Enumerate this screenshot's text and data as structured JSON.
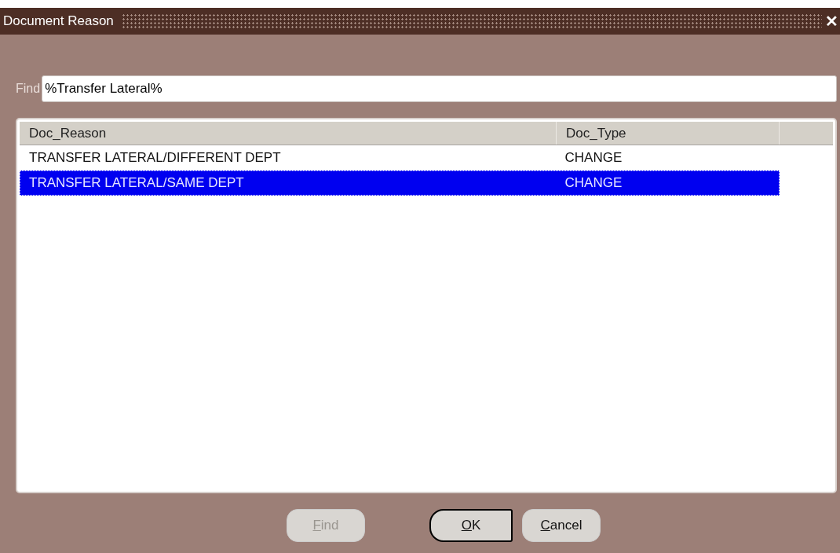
{
  "window": {
    "title": "Document Reason",
    "close": "✕"
  },
  "find": {
    "label": "Find",
    "value": "%Transfer Lateral%"
  },
  "table": {
    "columns": [
      "Doc_Reason",
      "Doc_Type"
    ],
    "rows": [
      {
        "cells": [
          "TRANSFER LATERAL/DIFFERENT DEPT",
          "CHANGE"
        ],
        "selected": false
      },
      {
        "cells": [
          "TRANSFER LATERAL/SAME DEPT",
          "CHANGE"
        ],
        "selected": true
      }
    ]
  },
  "buttons": [
    {
      "label": "Find",
      "disabled": true,
      "default": false
    },
    {
      "label": "OK",
      "disabled": false,
      "default": true
    },
    {
      "label": "Cancel",
      "disabled": false,
      "default": false
    }
  ]
}
